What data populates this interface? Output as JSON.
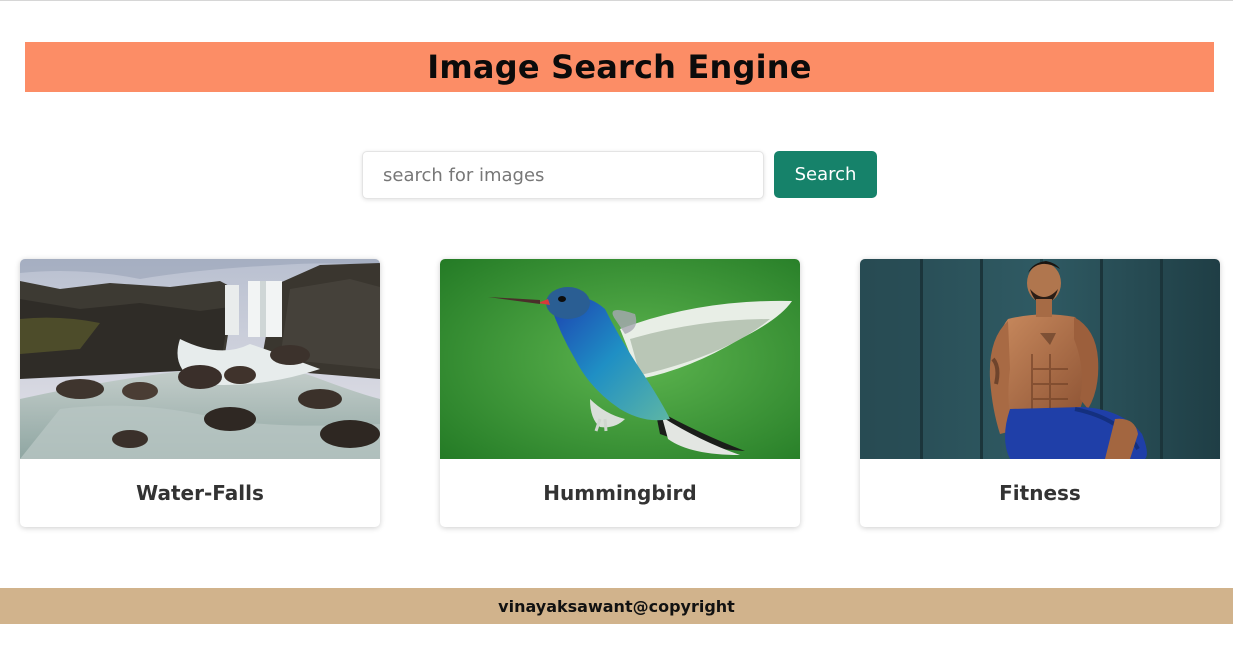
{
  "header": {
    "title": "Image Search Engine"
  },
  "search": {
    "placeholder": "search for images",
    "value": "",
    "button_label": "Search"
  },
  "results": [
    {
      "caption": "Water-Falls",
      "image": "waterfall-photo"
    },
    {
      "caption": "Hummingbird",
      "image": "hummingbird-photo"
    },
    {
      "caption": "Fitness",
      "image": "fitness-man-photo"
    }
  ],
  "footer": {
    "text": "vinayaksawant@copyright"
  },
  "colors": {
    "header_bg": "#fc8d66",
    "button_bg": "#16826a",
    "footer_bg": "#d1b38c"
  }
}
